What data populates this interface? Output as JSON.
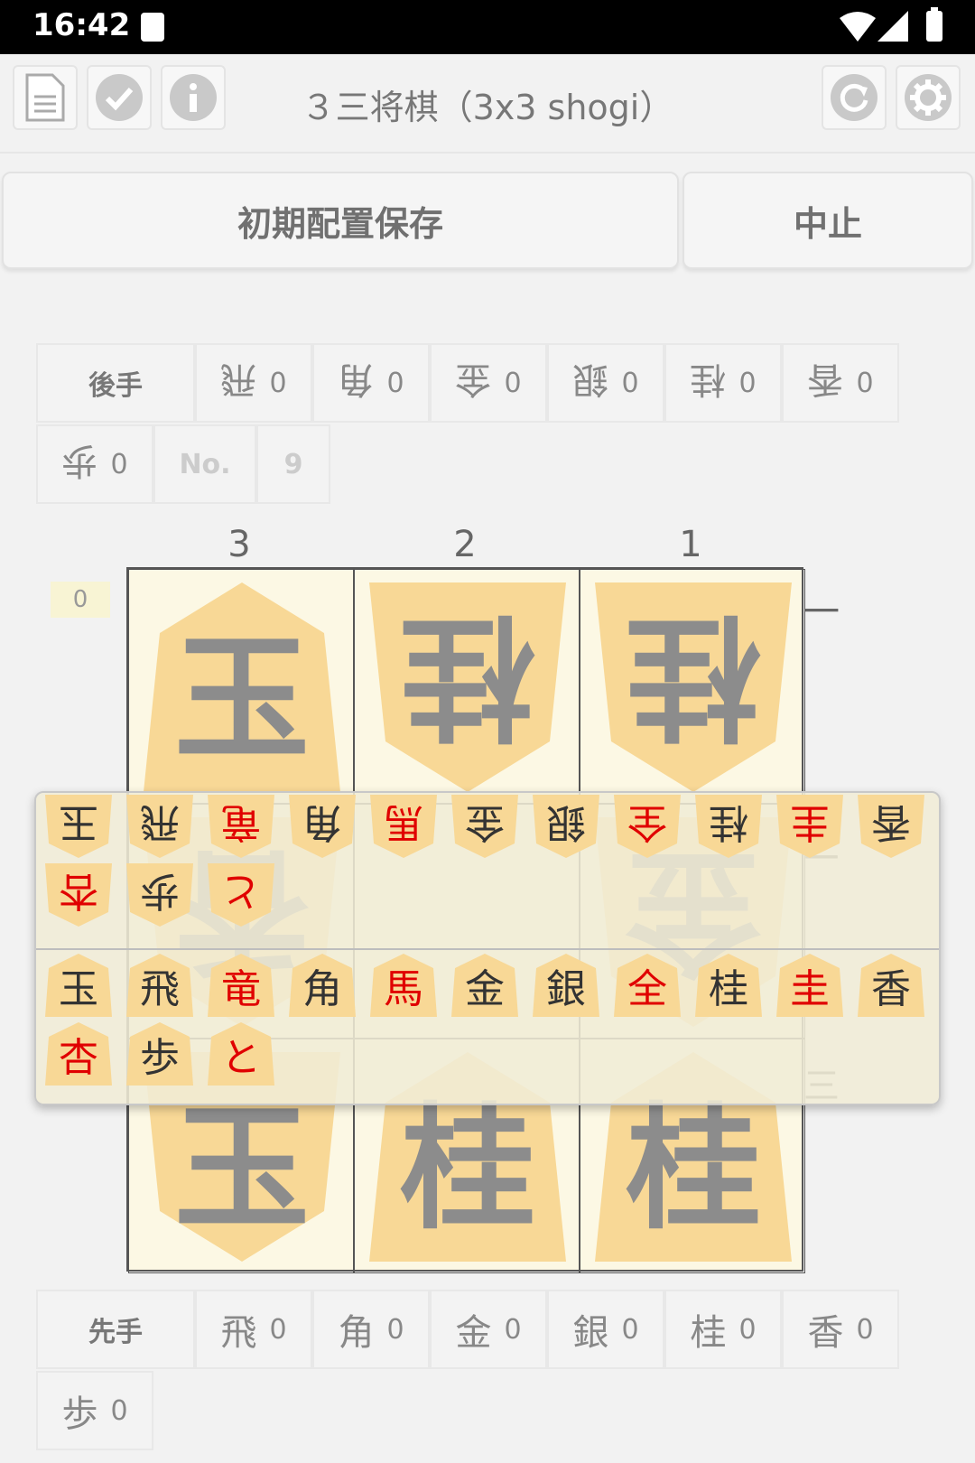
{
  "status_bar": {
    "time": "16:42"
  },
  "toolbar": {
    "title": "３三将棋（3x3 shogi）"
  },
  "actions": {
    "save_initial_label": "初期配置保存",
    "cancel_label": "中止"
  },
  "gote_hand": {
    "label": "後手",
    "pieces": [
      {
        "piece": "飛",
        "count": "0"
      },
      {
        "piece": "角",
        "count": "0"
      },
      {
        "piece": "金",
        "count": "0"
      },
      {
        "piece": "銀",
        "count": "0"
      },
      {
        "piece": "桂",
        "count": "0"
      },
      {
        "piece": "香",
        "count": "0"
      },
      {
        "piece": "歩",
        "count": "0"
      }
    ],
    "no_label": "No.",
    "no_value": "9"
  },
  "sente_hand": {
    "label": "先手",
    "pieces": [
      {
        "piece": "飛",
        "count": "0"
      },
      {
        "piece": "角",
        "count": "0"
      },
      {
        "piece": "金",
        "count": "0"
      },
      {
        "piece": "銀",
        "count": "0"
      },
      {
        "piece": "桂",
        "count": "0"
      },
      {
        "piece": "香",
        "count": "0"
      },
      {
        "piece": "歩",
        "count": "0"
      }
    ]
  },
  "board": {
    "columns": [
      "3",
      "2",
      "1"
    ],
    "rows": [
      "一",
      "二",
      "三"
    ],
    "move_counter": "0",
    "pieces": {
      "r1c3": "玉",
      "r1c2": "桂",
      "r1c1": "桂",
      "r2c3": "香",
      "r2c1": "金",
      "r3c3": "玉",
      "r3c2": "桂",
      "r3c1": "桂"
    }
  },
  "palette": {
    "pieces": [
      "玉",
      "飛",
      "竜",
      "角",
      "馬",
      "金",
      "銀",
      "全",
      "桂",
      "圭",
      "香",
      "杏",
      "歩",
      "と"
    ]
  },
  "colors": {
    "piece_tile": "#f8d896",
    "promoted_text": "#e00000",
    "board_bg": "#fcf8e4"
  }
}
